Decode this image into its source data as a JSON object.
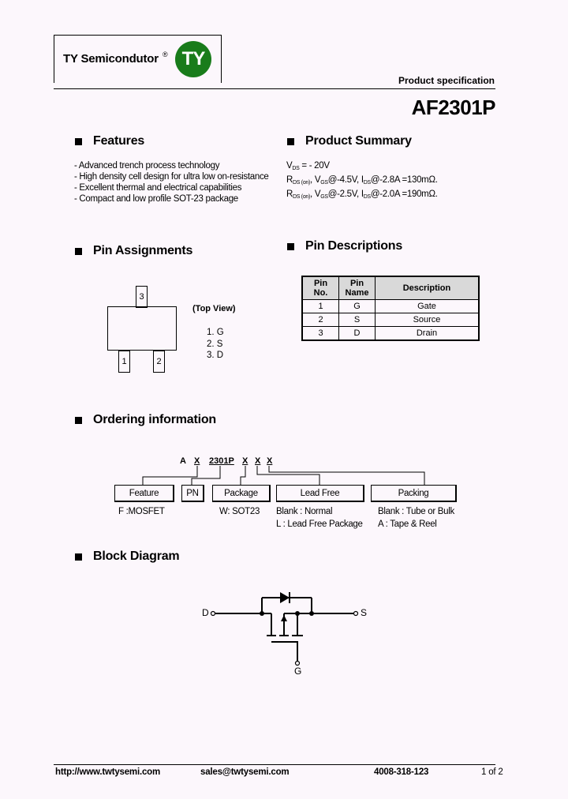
{
  "header": {
    "company": "TY Semicondutor",
    "registered_mark": "®",
    "logo_text": "TY",
    "logo_color": "#197c1b",
    "doc_type": "Product specification",
    "part_number": "AF2301P"
  },
  "features": {
    "title": "Features",
    "items": [
      "- Advanced trench process technology",
      "- High density cell design for ultra low on-resistance",
      "- Excellent thermal and electrical capabilities",
      "- Compact and low profile SOT-23 package"
    ]
  },
  "summary": {
    "title": "Product Summary",
    "vds": {
      "sym": "V",
      "sub": "DS",
      "text": " = - 20V"
    },
    "rows": [
      {
        "r": "R",
        "rsub": "DS (on)",
        "v": ", V",
        "vsub": "GS",
        "vtext": "@-4.5V, I",
        "isub": "DS",
        "itext": "@-2.8A =130mΩ."
      },
      {
        "r": "R",
        "rsub": "DS (on)",
        "v": ", V",
        "vsub": "GS",
        "vtext": "@-2.5V, I",
        "isub": "DS",
        "itext": "@-2.0A =190mΩ."
      }
    ]
  },
  "pin_assignments": {
    "title": "Pin Assignments",
    "view": "(Top View)",
    "pin_labels": [
      "1",
      "2",
      "3"
    ],
    "list": [
      "1. G",
      "2. S",
      "3. D"
    ]
  },
  "pin_descriptions": {
    "title": "Pin Descriptions",
    "headers": [
      "Pin No.",
      "Pin Name",
      "Description"
    ],
    "header_lines": [
      [
        "Pin",
        "No."
      ],
      [
        "Pin",
        "Name"
      ],
      [
        "Description"
      ]
    ],
    "rows": [
      [
        "1",
        "G",
        "Gate"
      ],
      [
        "2",
        "S",
        "Source"
      ],
      [
        "3",
        "D",
        "Drain"
      ]
    ]
  },
  "ordering": {
    "title": "Ordering information",
    "code": [
      "A",
      "X",
      "2301P",
      "X",
      "X",
      "X"
    ],
    "boxes": [
      "Feature",
      "PN",
      "Package",
      "Lead Free",
      "Packing"
    ],
    "notes": {
      "feature": "F :MOSFET",
      "package": "W: SOT23",
      "lead_free": [
        "Blank : Normal",
        "L : Lead Free Package"
      ],
      "packing": [
        "Blank : Tube or Bulk",
        "A  : Tape & Reel"
      ]
    }
  },
  "block_diagram": {
    "title": "Block Diagram",
    "terminals": {
      "drain": "D",
      "source": "S",
      "gate": "G"
    }
  },
  "footer": {
    "website": "http://www.twtysemi.com",
    "email": "sales@twtysemi.com",
    "phone": "4008-318-123",
    "page": "1 of 2"
  }
}
